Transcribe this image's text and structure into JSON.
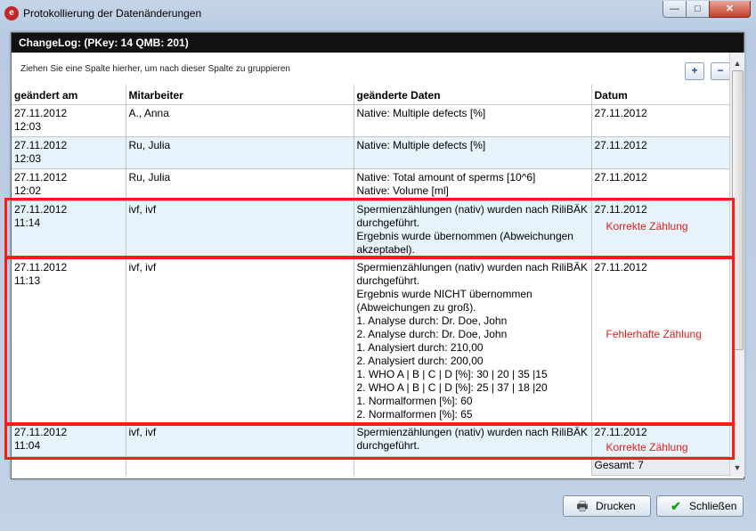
{
  "window": {
    "title": "Protokollierung der Datenänderungen",
    "app_icon": "e",
    "controls": {
      "minimize": "—",
      "maximize": "□",
      "close": "✕"
    }
  },
  "panel": {
    "header": "ChangeLog: (PKey: 14    QMB: 201)",
    "grouping_hint": "Ziehen Sie eine Spalte hierher, um nach dieser Spalte zu gruppieren",
    "expand_label": "+",
    "collapse_label": "−"
  },
  "table": {
    "columns": [
      "geändert am",
      "Mitarbeiter",
      "geänderte Daten",
      "Datum"
    ],
    "rows": [
      {
        "changed": "27.11.2012\n12:03",
        "employee": "A., Anna",
        "data": "Native: Multiple defects [%]",
        "date": "27.11.2012",
        "note": ""
      },
      {
        "changed": "27.11.2012\n12:03",
        "employee": "Ru, Julia",
        "data": "Native: Multiple defects [%]",
        "date": "27.11.2012",
        "note": ""
      },
      {
        "changed": "27.11.2012\n12:02",
        "employee": "Ru, Julia",
        "data": "Native: Total amount of sperms [10^6]\nNative: Volume [ml]",
        "date": "27.11.2012",
        "note": ""
      },
      {
        "changed": "27.11.2012\n11:14",
        "employee": "ivf, ivf",
        "data": "Spermienzählungen (nativ) wurden nach RiliBÄK durchgeführt.\nErgebnis wurde übernommen (Abweichungen akzeptabel).",
        "date": "27.11.2012",
        "note": "Korrekte Zählung"
      },
      {
        "changed": "27.11.2012\n11:13",
        "employee": "ivf, ivf",
        "data": "Spermienzählungen (nativ) wurden nach RiliBÄK durchgeführt.\nErgebnis wurde NICHT übernommen (Abweichungen zu groß).\n1. Analyse durch: Dr. Doe, John\n2. Analyse durch: Dr. Doe, John\n1. Analysiert durch: 210,00\n2. Analysiert durch: 200,00\n1. WHO A | B | C | D [%]: 30 | 20 | 35 |15\n2. WHO A | B | C | D [%]: 25 | 37 | 18 |20\n1. Normalformen [%]: 60\n2. Normalformen [%]: 65",
        "date": "27.11.2012",
        "note": "Fehlerhafte Zählung"
      },
      {
        "changed": "27.11.2012\n11:04",
        "employee": "ivf, ivf",
        "data": "Spermienzählungen (nativ) wurden nach RiliBÄK durchgeführt.",
        "date": "27.11.2012",
        "note": "Korrekte Zählung"
      }
    ],
    "footer_total": "Gesamt: 7"
  },
  "buttons": {
    "print": "Drucken",
    "close": "Schließen"
  },
  "colors": {
    "highlight": "#ff1a1a",
    "annotation": "#e21c1c",
    "row_alt": "#e6f3fb"
  }
}
